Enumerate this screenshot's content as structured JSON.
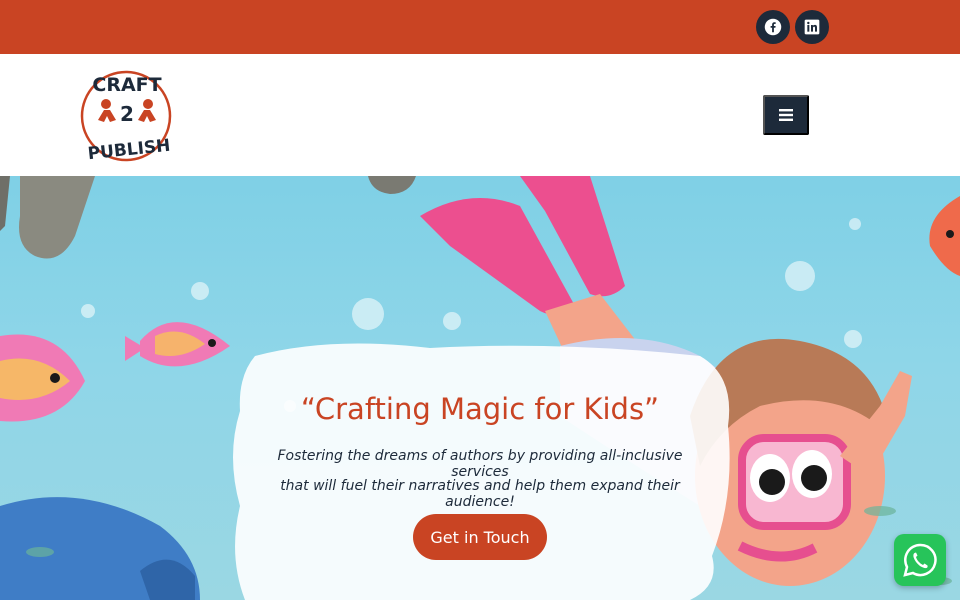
{
  "topbar": {
    "social": [
      {
        "icon": "facebook-icon",
        "label": "Facebook"
      },
      {
        "icon": "linkedin-icon",
        "label": "LinkedIn"
      }
    ],
    "bg_color": "#c94423"
  },
  "header": {
    "logo": {
      "line1": "CRAFT",
      "mid": "2",
      "line2": "PUBLISH"
    },
    "menu_icon": "hamburger-icon"
  },
  "hero": {
    "title": "“Crafting Magic for Kids”",
    "subtitle_line1": "Fostering the dreams of authors by providing all-inclusive services",
    "subtitle_line2": "that will fuel their narratives and help them expand their audience!",
    "cta_label": "Get in Touch"
  },
  "floating": {
    "whatsapp_icon": "whatsapp-icon"
  },
  "colors": {
    "accent": "#c94423",
    "dark": "#1d2a3a",
    "whatsapp": "#27c45a"
  }
}
